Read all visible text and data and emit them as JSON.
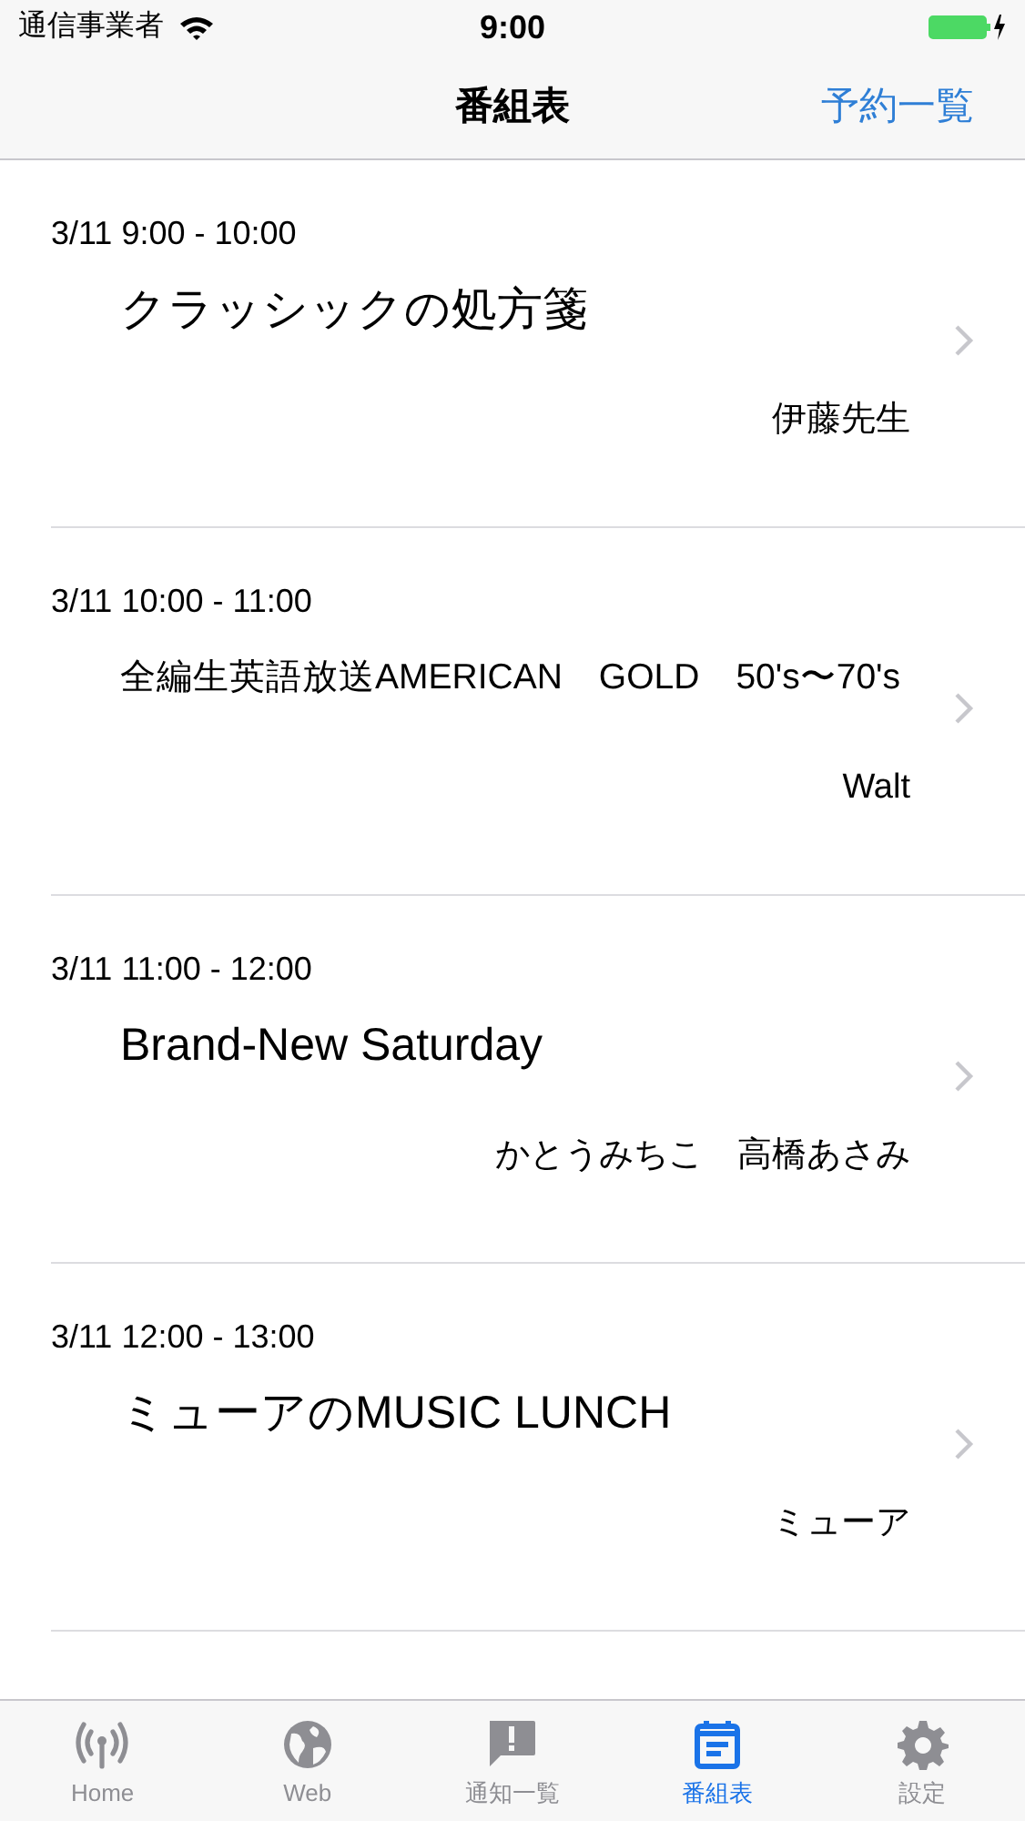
{
  "status_bar": {
    "carrier": "通信事業者",
    "time": "9:00"
  },
  "nav_bar": {
    "title": "番組表",
    "right_button": "予約一覧"
  },
  "programs": [
    {
      "time": "3/11 9:00 - 10:00",
      "title": "クラッシックの処方箋",
      "performer": "伊藤先生"
    },
    {
      "time": "3/11 10:00 - 11:00",
      "title": "全編生英語放送AMERICAN　GOLD　50's〜70's",
      "performer": "Walt"
    },
    {
      "time": "3/11 11:00 - 12:00",
      "title": "Brand-New Saturday",
      "performer": "かとうみちこ　高橋あさみ"
    },
    {
      "time": "3/11 12:00 - 13:00",
      "title": "ミューアのMUSIC LUNCH",
      "performer": "ミューア"
    }
  ],
  "tab_bar": [
    {
      "kind": "antenna",
      "label": "Home",
      "selected": false
    },
    {
      "kind": "globe",
      "label": "Web",
      "selected": false
    },
    {
      "kind": "alert",
      "label": "通知一覧",
      "selected": false
    },
    {
      "kind": "calendar",
      "label": "番組表",
      "selected": true
    },
    {
      "kind": "gear",
      "label": "設定",
      "selected": false
    }
  ]
}
